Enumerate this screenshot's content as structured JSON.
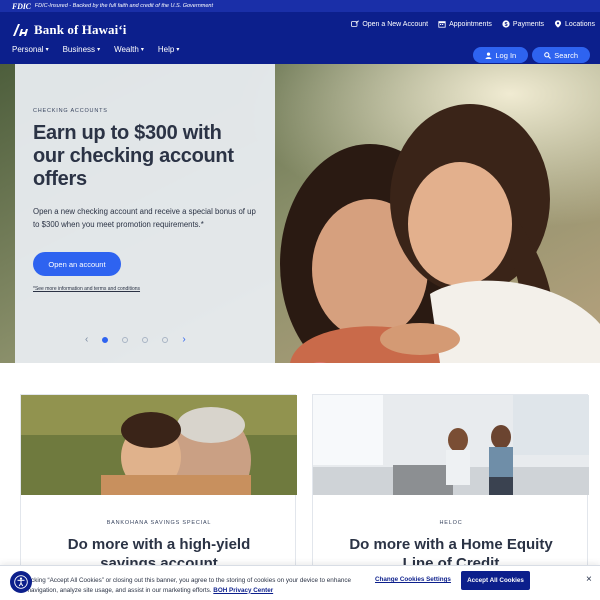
{
  "fdic": {
    "logo": "FDIC",
    "text": "FDIC-Insured - Backed by the full faith and credit of the U.S. Government"
  },
  "header": {
    "brand": "Bank of Hawai‘i",
    "utility_links": [
      {
        "label": "Open a New Account",
        "icon": "open-account-icon"
      },
      {
        "label": "Appointments",
        "icon": "calendar-icon"
      },
      {
        "label": "Payments",
        "icon": "dollar-icon"
      },
      {
        "label": "Locations",
        "icon": "location-pin-icon"
      }
    ],
    "nav": [
      {
        "label": "Personal"
      },
      {
        "label": "Business"
      },
      {
        "label": "Wealth"
      },
      {
        "label": "Help"
      }
    ],
    "login_label": "Log In",
    "search_label": "Search"
  },
  "hero": {
    "eyebrow": "CHECKING ACCOUNTS",
    "title": "Earn up to $300 with our checking account offers",
    "body": "Open a new checking account and receive a special bonus of up to $300 when you meet promotion requirements.*",
    "cta": "Open an account",
    "fineprint": "*See more information and terms and conditions",
    "carousel": {
      "slides": 4,
      "active": 1
    }
  },
  "cards": [
    {
      "eyebrow": "BANKOHANA SAVINGS SPECIAL",
      "title": "Do more with a high-yield savings account"
    },
    {
      "eyebrow": "HELOC",
      "title": "Do more with a Home Equity Line of Credit"
    }
  ],
  "cookie": {
    "text_before": "By clicking “Accept All Cookies” or closing out this banner, you agree to the storing of cookies on your device to enhance site navigation, analyze site usage, and assist in our marketing efforts.",
    "privacy_link": "BOH Privacy Center",
    "settings_label": "Change Cookies Settings",
    "accept_label": "Accept All Cookies",
    "close_symbol": "×"
  },
  "colors": {
    "navy": "#0c1f8c",
    "fdic_blue": "#1a2fa8",
    "accent_blue": "#2e63f0"
  }
}
